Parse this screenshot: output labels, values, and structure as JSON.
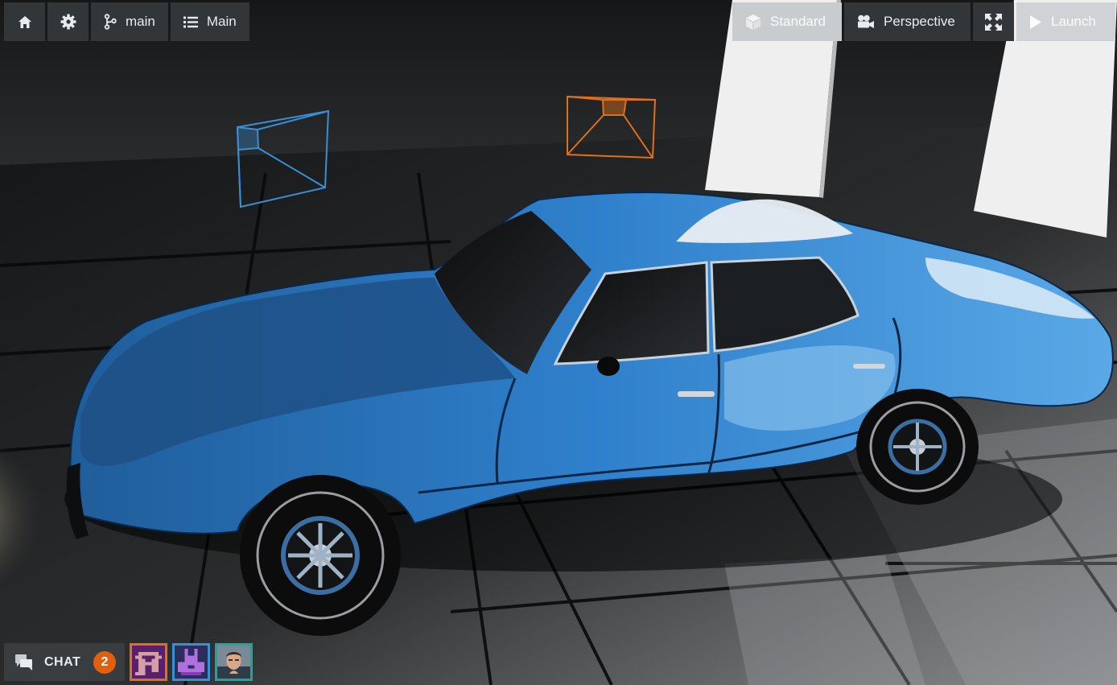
{
  "toolbar_left": {
    "home_icon": "home-icon",
    "settings_icon": "gear-icon",
    "branch": {
      "icon": "branch-icon",
      "label": "main"
    },
    "scene": {
      "icon": "list-icon",
      "label": "Main"
    }
  },
  "toolbar_right": {
    "mode": {
      "icon": "cube-icon",
      "label": "Standard"
    },
    "camera": {
      "icon": "video-camera-icon",
      "label": "Perspective"
    },
    "fullscreen_icon": "expand-icon",
    "launch": {
      "icon": "play-icon",
      "label": "Launch"
    }
  },
  "chat": {
    "icon": "chat-bubbles-icon",
    "label": "CHAT",
    "count": "2"
  },
  "avatars": [
    {
      "name": "avatar-purple-pixel",
      "border": "#e0701a"
    },
    {
      "name": "avatar-violet-pixel",
      "border": "#3a8fd4"
    },
    {
      "name": "avatar-photo",
      "border": "#1aa89a"
    }
  ],
  "colors": {
    "car_body": "#2f7fc8",
    "camera_blue": "#3a8fd4",
    "camera_orange": "#e0701a",
    "badge": "#e06010"
  }
}
